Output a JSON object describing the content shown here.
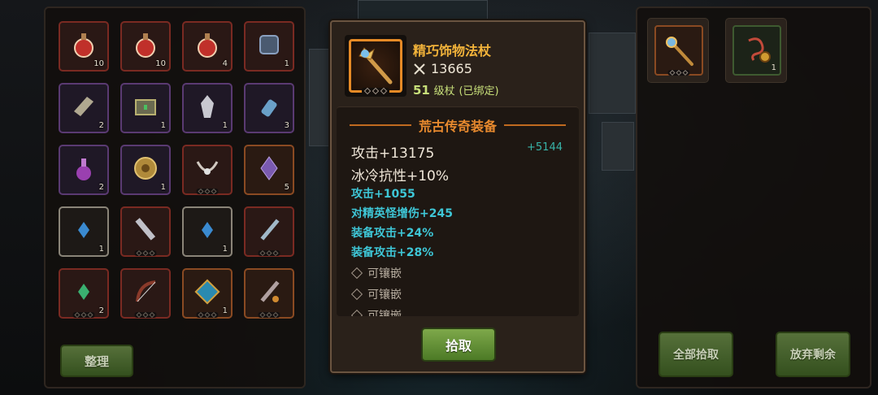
{
  "inventory": {
    "slots": [
      {
        "icon": "red-potion-icon",
        "quality": "red",
        "count": "10"
      },
      {
        "icon": "red-potion-icon",
        "quality": "red",
        "count": "10"
      },
      {
        "icon": "red-potion-icon",
        "quality": "red",
        "count": "4"
      },
      {
        "icon": "blue-rune-stone-icon",
        "quality": "red",
        "count": "1"
      },
      {
        "icon": "cloth-scroll-icon",
        "quality": "purple",
        "count": "2"
      },
      {
        "icon": "treasure-chest-icon",
        "quality": "purple",
        "count": "1"
      },
      {
        "icon": "white-crystal-icon",
        "quality": "purple",
        "count": "1"
      },
      {
        "icon": "blue-bottle-icon",
        "quality": "purple",
        "count": "3"
      },
      {
        "icon": "purple-potion-icon",
        "quality": "purple",
        "count": "2"
      },
      {
        "icon": "bronze-coin-icon",
        "quality": "purple",
        "count": "1"
      },
      {
        "icon": "necklace-icon",
        "quality": "red",
        "count": ""
      },
      {
        "icon": "purple-crystal-icon",
        "quality": "orange",
        "count": "5"
      },
      {
        "icon": "blue-gem-icon",
        "quality": "grey",
        "count": "1"
      },
      {
        "icon": "greatsword-icon",
        "quality": "red",
        "count": ""
      },
      {
        "icon": "blue-gem-icon",
        "quality": "grey",
        "count": "1"
      },
      {
        "icon": "sword-icon",
        "quality": "red",
        "count": ""
      },
      {
        "icon": "green-gem-icon",
        "quality": "red",
        "count": "2"
      },
      {
        "icon": "bow-icon",
        "quality": "red",
        "count": ""
      },
      {
        "icon": "blue-amulet-icon",
        "quality": "orange",
        "count": "1"
      },
      {
        "icon": "ornate-sword-icon",
        "quality": "orange",
        "count": ""
      }
    ],
    "sort_button": "整理"
  },
  "tooltip": {
    "item_name": "精巧饰物法杖",
    "power": "13665",
    "level": "51",
    "level_label": "级杖",
    "bound_label": "(已绑定)",
    "rarity": "荒古传奇装备",
    "base_stats": [
      "攻击+13175",
      "冰冷抗性+10%"
    ],
    "diff": "+5144",
    "extra_stats": [
      "攻击+1055",
      "对精英怪增伤+245",
      "装备攻击+24%",
      "装备攻击+28%"
    ],
    "sockets": [
      "可镶嵌",
      "可镶嵌",
      "可镶嵌"
    ],
    "pickup_button": "拾取"
  },
  "loot": {
    "slots": [
      {
        "icon": "staff-icon",
        "quality": "orange",
        "count": ""
      },
      {
        "icon": "rope-amulet-icon",
        "quality": "green",
        "count": "1"
      }
    ],
    "pickup_all_button": "全部拾取",
    "discard_rest_button": "放弃剩余"
  },
  "colors": {
    "legendary": "#e88a2e",
    "item_name": "#f2b33a",
    "extra_stat": "#3ec6d6",
    "button_green": "#6a9640"
  }
}
